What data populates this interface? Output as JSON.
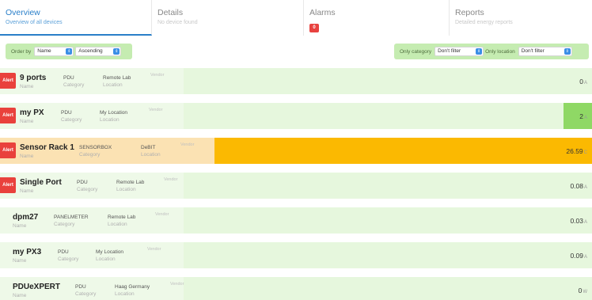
{
  "tabs": [
    {
      "title": "Overview",
      "subtitle": "Overview of all devices",
      "active": true,
      "badge": ""
    },
    {
      "title": "Details",
      "subtitle": "No device found",
      "active": false,
      "badge": ""
    },
    {
      "title": "Alarms",
      "subtitle": "",
      "active": false,
      "badge": "0"
    },
    {
      "title": "Reports",
      "subtitle": "Detailed energy reports",
      "active": false,
      "badge": ""
    }
  ],
  "filters": {
    "order_by_label": "Order by",
    "order_by_value": "Name",
    "order_dir_value": "Ascending",
    "category_label": "Only category",
    "category_value": "Don't filter",
    "location_label": "Only location",
    "location_value": "Don't filter"
  },
  "labels": {
    "name": "Name",
    "category": "Category",
    "location": "Location",
    "vendor": "Vendor",
    "alert": "Alert"
  },
  "colors": {
    "row_bg": "#e6f7dd",
    "fill_green": "#8fd865",
    "fill_light": "#d8f2c8",
    "highlight_bg": "#fbe2b3",
    "fill_orange": "#fbb901",
    "alert": "#e9413c",
    "accent": "#2a7fc9"
  },
  "devices": [
    {
      "name": "9 ports",
      "category": "PDU",
      "location": "Remote Lab",
      "value": "0",
      "unit": "A",
      "alert": true,
      "level": 0.0,
      "highlight": false
    },
    {
      "name": "my PX",
      "category": "PDU",
      "location": "My Location",
      "value": "2",
      "unit": "A",
      "alert": true,
      "level": 0.07,
      "highlight": false
    },
    {
      "name": "Sensor Rack 1",
      "category": "SENSORBOX",
      "location": "DeBIT",
      "value": "26.59",
      "unit": "C",
      "alert": true,
      "level": 1.0,
      "highlight": true
    },
    {
      "name": "Single Port",
      "category": "PDU",
      "location": "Remote Lab",
      "value": "0.08",
      "unit": "A",
      "alert": true,
      "level": 0.0,
      "highlight": false
    },
    {
      "name": "dpm27",
      "category": "PANELMETER",
      "location": "Remote Lab",
      "value": "0.03",
      "unit": "A",
      "alert": false,
      "level": 0.0,
      "highlight": false
    },
    {
      "name": "my PX3",
      "category": "PDU",
      "location": "My Location",
      "value": "0.09",
      "unit": "A",
      "alert": false,
      "level": 0.0,
      "highlight": false
    },
    {
      "name": "PDUeXPERT",
      "category": "PDU",
      "location": "Haag Germany",
      "value": "0",
      "unit": "W",
      "alert": false,
      "level": 0.0,
      "highlight": false
    }
  ]
}
